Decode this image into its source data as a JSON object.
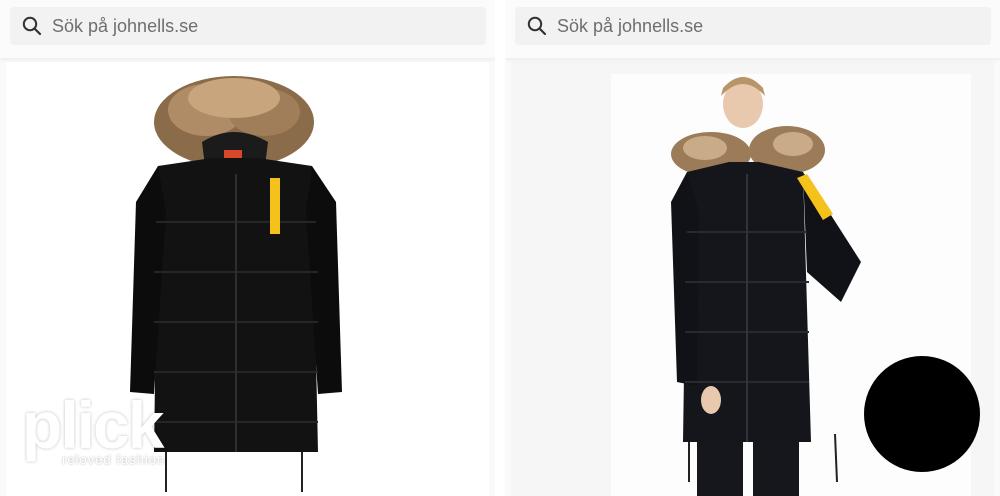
{
  "panels": [
    {
      "search": {
        "placeholder": "Sök på johnells.se"
      },
      "image": {
        "subject": "black down parka with fur hood"
      }
    },
    {
      "search": {
        "placeholder": "Sök på johnells.se"
      },
      "image": {
        "subject": "model wearing black down parka"
      }
    }
  ],
  "watermark": {
    "logo": "plick",
    "tagline": "reloved fashion"
  },
  "icons": {
    "search": "search-icon"
  },
  "colors": {
    "accent_tab": "#f5c21b",
    "coat": "#111111",
    "search_bg": "#f2f2f2"
  }
}
